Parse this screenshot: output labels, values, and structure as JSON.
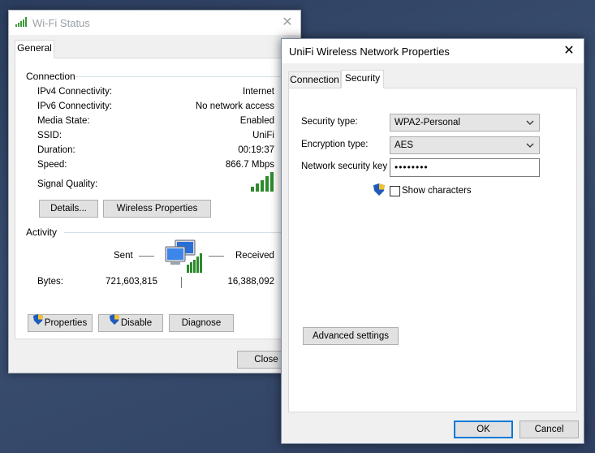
{
  "status": {
    "title": "Wi-Fi Status",
    "tab_general": "General",
    "connection_group": "Connection",
    "rows": [
      {
        "label": "IPv4 Connectivity:",
        "value": "Internet"
      },
      {
        "label": "IPv6 Connectivity:",
        "value": "No network access"
      },
      {
        "label": "Media State:",
        "value": "Enabled"
      },
      {
        "label": "SSID:",
        "value": "UniFi"
      },
      {
        "label": "Duration:",
        "value": "00:19:37"
      },
      {
        "label": "Speed:",
        "value": "866.7 Mbps"
      }
    ],
    "signal_label": "Signal Quality:",
    "signal_bars": 5,
    "details_button": "Details...",
    "wireless_props_button": "Wireless Properties",
    "activity_group": "Activity",
    "sent_label": "Sent",
    "received_label": "Received",
    "bytes_label": "Bytes:",
    "bytes_sent": "721,603,815",
    "bytes_received": "16,388,092",
    "properties_button": "Properties",
    "disable_button": "Disable",
    "diagnose_button": "Diagnose",
    "close_button": "Close"
  },
  "props": {
    "title": "UniFi Wireless Network Properties",
    "tab_connection": "Connection",
    "tab_security": "Security",
    "security_type_label": "Security type:",
    "security_type_value": "WPA2-Personal",
    "encryption_type_label": "Encryption type:",
    "encryption_type_value": "AES",
    "network_key_label": "Network security key",
    "network_key_value": "••••••••",
    "show_characters_label": "Show characters",
    "advanced_button": "Advanced settings",
    "ok_button": "OK",
    "cancel_button": "Cancel"
  },
  "icons": {
    "wifi": "wifi-signal-icon",
    "shield": "uac-shield-icon",
    "computers": "network-computers-icon",
    "close": "close-icon",
    "dropdown": "chevron-down-icon"
  },
  "colors": {
    "accent": "#0078d7",
    "signal": "#2c8a2c",
    "desktop": "#2f4163"
  }
}
